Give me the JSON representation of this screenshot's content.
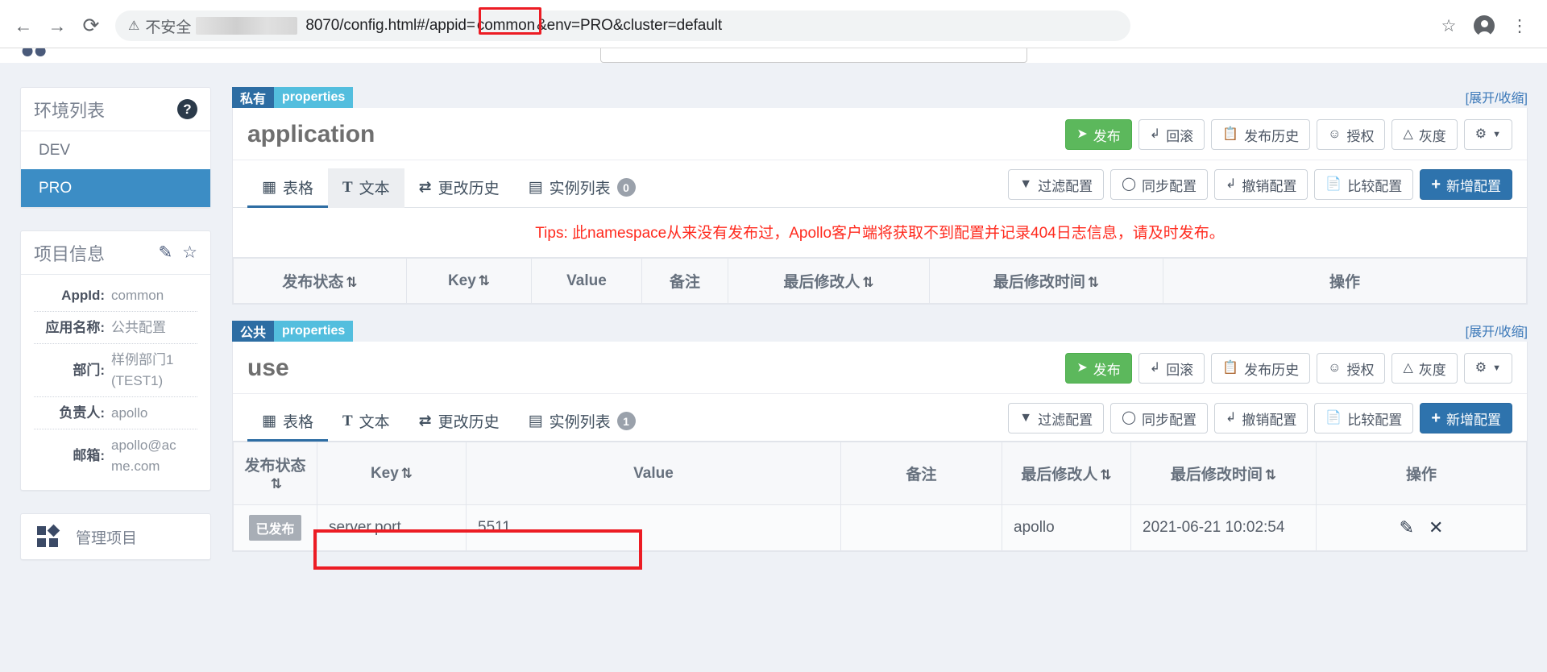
{
  "browser": {
    "back_icon": "back-arrow-icon",
    "forward_icon": "forward-arrow-icon",
    "reload_icon": "reload-icon",
    "warning_label": "不安全",
    "url_prefix": "8070/config.html#/appid=",
    "url_highlight": "common",
    "url_suffix": "&env=PRO&cluster=default",
    "star_icon": "bookmark-star-icon",
    "profile_icon": "profile-avatar-icon",
    "menu_icon": "kebab-menu-icon"
  },
  "sidebar": {
    "env_panel": {
      "title": "环境列表",
      "help_icon": "question-mark-icon",
      "items": [
        {
          "label": "DEV",
          "active": false
        },
        {
          "label": "PRO",
          "active": true
        }
      ]
    },
    "project_panel": {
      "title": "项目信息",
      "edit_icon": "edit-pencil-icon",
      "favorite_icon": "star-outline-icon",
      "rows": [
        {
          "label": "AppId:",
          "value": "common"
        },
        {
          "label": "应用名称:",
          "value": "公共配置"
        },
        {
          "label": "部门:",
          "value": "样例部门1(TEST1)"
        },
        {
          "label": "负责人:",
          "value": "apollo"
        },
        {
          "label": "邮箱:",
          "value": "apollo@acme.com"
        }
      ]
    },
    "manage_panel": {
      "icon": "grid-squares-icon",
      "label": "管理项目"
    }
  },
  "namespaces": [
    {
      "scope_tag": "私有",
      "format_tag": "properties",
      "expand_link": "[展开/收缩]",
      "name": "application",
      "actions": [
        {
          "label": "发布",
          "icon": "send-icon",
          "style": "green"
        },
        {
          "label": "回滚",
          "icon": "undo-icon",
          "style": "default"
        },
        {
          "label": "发布历史",
          "icon": "clipboard-icon",
          "style": "default"
        },
        {
          "label": "授权",
          "icon": "person-icon",
          "style": "default"
        },
        {
          "label": "灰度",
          "icon": "flask-icon",
          "style": "default"
        },
        {
          "label": "",
          "icon": "gear-caret-icon",
          "style": "default"
        }
      ],
      "tabs": [
        {
          "label": "表格",
          "icon": "table-icon",
          "active": true,
          "hovered": false,
          "badge": null
        },
        {
          "label": "文本",
          "icon": "text-t-icon",
          "active": false,
          "hovered": true,
          "badge": null
        },
        {
          "label": "更改历史",
          "icon": "history-icon",
          "active": false,
          "hovered": false,
          "badge": null
        },
        {
          "label": "实例列表",
          "icon": "instances-icon",
          "active": false,
          "hovered": false,
          "badge": "0"
        }
      ],
      "tab_actions": [
        {
          "label": "过滤配置",
          "icon": "filter-icon",
          "style": "default"
        },
        {
          "label": "同步配置",
          "icon": "sync-icon",
          "style": "default"
        },
        {
          "label": "撤销配置",
          "icon": "undo-icon",
          "style": "default"
        },
        {
          "label": "比较配置",
          "icon": "compare-icon",
          "style": "default"
        },
        {
          "label": "新增配置",
          "icon": "plus-icon",
          "style": "blue"
        }
      ],
      "tips": "Tips: 此namespace从来没有发布过，Apollo客户端将获取不到配置并记录404日志信息，请及时发布。",
      "columns": [
        {
          "label": "发布状态",
          "sortable": true
        },
        {
          "label": "Key",
          "sortable": true
        },
        {
          "label": "Value",
          "sortable": false
        },
        {
          "label": "备注",
          "sortable": false
        },
        {
          "label": "最后修改人",
          "sortable": true
        },
        {
          "label": "最后修改时间",
          "sortable": true
        },
        {
          "label": "操作",
          "sortable": false
        }
      ],
      "rows": []
    },
    {
      "scope_tag": "公共",
      "format_tag": "properties",
      "expand_link": "[展开/收缩]",
      "name": "use",
      "actions": [
        {
          "label": "发布",
          "icon": "send-icon",
          "style": "green"
        },
        {
          "label": "回滚",
          "icon": "undo-icon",
          "style": "default"
        },
        {
          "label": "发布历史",
          "icon": "clipboard-icon",
          "style": "default"
        },
        {
          "label": "授权",
          "icon": "person-icon",
          "style": "default"
        },
        {
          "label": "灰度",
          "icon": "flask-icon",
          "style": "default"
        },
        {
          "label": "",
          "icon": "gear-caret-icon",
          "style": "default"
        }
      ],
      "tabs": [
        {
          "label": "表格",
          "icon": "table-icon",
          "active": true,
          "hovered": false,
          "badge": null
        },
        {
          "label": "文本",
          "icon": "text-t-icon",
          "active": false,
          "hovered": false,
          "badge": null
        },
        {
          "label": "更改历史",
          "icon": "history-icon",
          "active": false,
          "hovered": false,
          "badge": null
        },
        {
          "label": "实例列表",
          "icon": "instances-icon",
          "active": false,
          "hovered": false,
          "badge": "1"
        }
      ],
      "tab_actions": [
        {
          "label": "过滤配置",
          "icon": "filter-icon",
          "style": "default"
        },
        {
          "label": "同步配置",
          "icon": "sync-icon",
          "style": "default"
        },
        {
          "label": "撤销配置",
          "icon": "undo-icon",
          "style": "default"
        },
        {
          "label": "比较配置",
          "icon": "compare-icon",
          "style": "default"
        },
        {
          "label": "新增配置",
          "icon": "plus-icon",
          "style": "blue"
        }
      ],
      "tips": null,
      "columns": [
        {
          "label": "发布状态",
          "sortable": true
        },
        {
          "label": "Key",
          "sortable": true
        },
        {
          "label": "Value",
          "sortable": false
        },
        {
          "label": "备注",
          "sortable": false
        },
        {
          "label": "最后修改人",
          "sortable": true
        },
        {
          "label": "最后修改时间",
          "sortable": true
        },
        {
          "label": "操作",
          "sortable": false
        }
      ],
      "rows": [
        {
          "status": "已发布",
          "key": "server.port",
          "value": "5511",
          "comment": "",
          "modified_by": "apollo",
          "modified_at": "2021-06-21 10:02:54",
          "edit_icon": "edit-pencil-icon",
          "delete_icon": "close-x-icon"
        }
      ]
    }
  ],
  "annotations": {
    "highlight_color": "#ec1c24"
  }
}
